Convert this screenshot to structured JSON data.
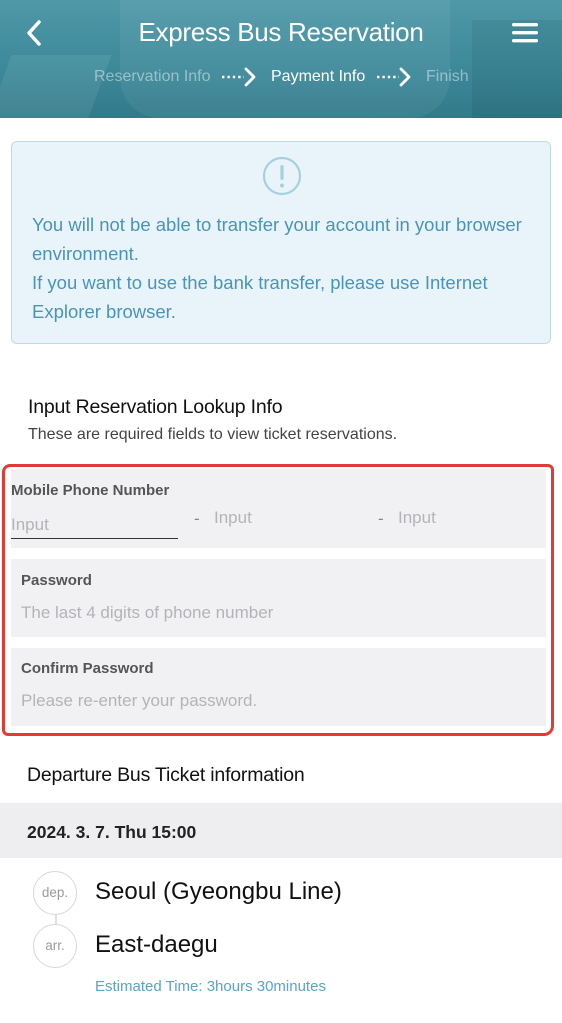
{
  "header": {
    "title": "Express Bus Reservation",
    "steps": [
      "Reservation Info",
      "Payment Info",
      "Finish"
    ],
    "active_step": 1
  },
  "notice": {
    "icon": "exclamation-circle-icon",
    "line1": "You will not be able to transfer your account in your browser environment.",
    "line2": "If you want to use the bank transfer, please use Internet Explorer browser."
  },
  "lookup": {
    "title": "Input Reservation Lookup Info",
    "subtitle": "These are required fields to view ticket reservations.",
    "phone": {
      "label": "Mobile Phone Number",
      "part1_placeholder": "Input",
      "part2_placeholder": "Input",
      "part3_placeholder": "Input",
      "separator": "-"
    },
    "password": {
      "label": "Password",
      "placeholder": "The last 4 digits of phone number"
    },
    "confirm": {
      "label": "Confirm Password",
      "placeholder": "Please re-enter your password."
    }
  },
  "departure": {
    "title": "Departure Bus Ticket information",
    "datetime": "2024. 3. 7. Thu 15:00",
    "dep_tag": "dep.",
    "origin": "Seoul (Gyeongbu Line)",
    "arr_tag": "arr.",
    "destination": "East-daegu",
    "estimated": "Estimated Time: 3hours 30minutes"
  },
  "colors": {
    "header": "#3d8a9b",
    "notice_bg": "#e9f4fa",
    "notice_text": "#4b94b8",
    "highlight": "#e53935"
  }
}
